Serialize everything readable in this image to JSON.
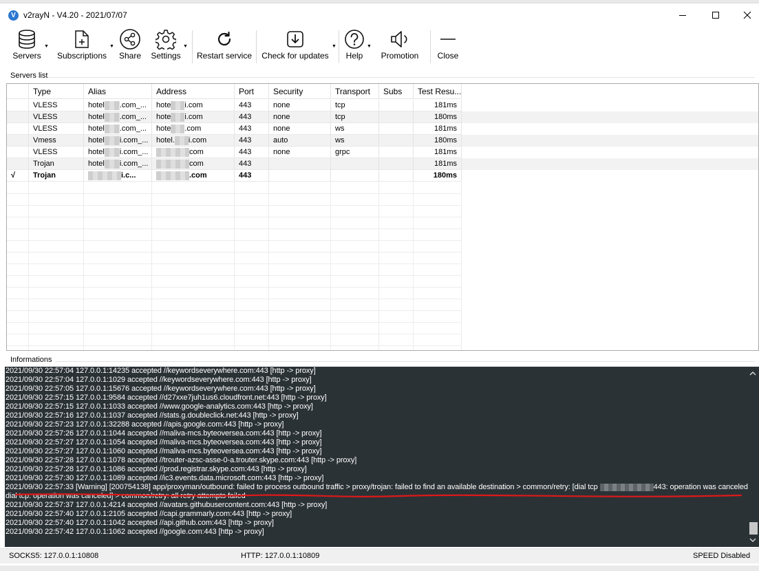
{
  "window": {
    "title": "v2rayN - V4.20 - 2021/07/07",
    "app_icon_letter": "V"
  },
  "toolbar": {
    "items": [
      {
        "label": "Servers",
        "icon": "database-icon",
        "dropdown": true
      },
      {
        "label": "Subscriptions",
        "icon": "document-plus-icon",
        "dropdown": true
      },
      {
        "label": "Share",
        "icon": "share-icon",
        "dropdown": false
      },
      {
        "label": "Settings",
        "icon": "gear-icon",
        "dropdown": true
      },
      {
        "label": "Restart service",
        "icon": "restart-icon",
        "dropdown": false
      },
      {
        "label": "Check for updates",
        "icon": "download-icon",
        "dropdown": true
      },
      {
        "label": "Help",
        "icon": "help-icon",
        "dropdown": true
      },
      {
        "label": "Promotion",
        "icon": "speaker-icon",
        "dropdown": false
      },
      {
        "label": "Close",
        "icon": "minus-icon",
        "dropdown": false
      }
    ]
  },
  "servers_section": {
    "label": "Servers list"
  },
  "servers_table": {
    "columns": [
      "",
      "Type",
      "Alias",
      "Address",
      "Port",
      "Security",
      "Transport",
      "Subs",
      "Test Resu..."
    ],
    "rows": [
      {
        "active": "",
        "type": "VLESS",
        "alias_a": "hotel",
        "alias_b": ".com_...",
        "address_a": "hote",
        "address_b": "i.com",
        "port": "443",
        "security": "none",
        "transport": "tcp",
        "subs": "",
        "test": "181ms"
      },
      {
        "active": "",
        "type": "VLESS",
        "alias_a": "hotel",
        "alias_b": ".com_...",
        "address_a": "hote",
        "address_b": "i.com",
        "port": "443",
        "security": "none",
        "transport": "tcp",
        "subs": "",
        "test": "180ms"
      },
      {
        "active": "",
        "type": "VLESS",
        "alias_a": "hotel",
        "alias_b": ".com_...",
        "address_a": "hote",
        "address_b": ".com",
        "port": "443",
        "security": "none",
        "transport": "ws",
        "subs": "",
        "test": "181ms"
      },
      {
        "active": "",
        "type": "Vmess",
        "alias_a": "hotel",
        "alias_b": "i.com_...",
        "address_a": "hotel.",
        "address_b": "i.com",
        "port": "443",
        "security": "auto",
        "transport": "ws",
        "subs": "",
        "test": "180ms"
      },
      {
        "active": "",
        "type": "VLESS",
        "alias_a": "hotel",
        "alias_b": "i.com_...",
        "address_a": "",
        "address_b": "com",
        "port": "443",
        "security": "none",
        "transport": "grpc",
        "subs": "",
        "test": "181ms"
      },
      {
        "active": "",
        "type": "Trojan",
        "alias_a": "hotel",
        "alias_b": "i.com_...",
        "address_a": "",
        "address_b": "com",
        "port": "443",
        "security": "",
        "transport": "",
        "subs": "",
        "test": "181ms"
      },
      {
        "active": "√",
        "type": "Trojan",
        "alias_a": "",
        "alias_b": "i.c...",
        "address_a": "",
        "address_b": ".com",
        "port": "443",
        "security": "",
        "transport": "",
        "subs": "",
        "test": "180ms"
      }
    ]
  },
  "info_section": {
    "label": "Informations"
  },
  "log": {
    "lines": [
      {
        "text": "2021/09/30 22:57:04 127.0.0.1:14235 accepted //keywordseverywhere.com:443 [http -> proxy]"
      },
      {
        "text": "2021/09/30 22:57:04 127.0.0.1:1029 accepted //keywordseverywhere.com:443 [http -> proxy]"
      },
      {
        "text": "2021/09/30 22:57:05 127.0.0.1:15676 accepted //keywordseverywhere.com:443 [http -> proxy]"
      },
      {
        "text": "2021/09/30 22:57:15 127.0.0.1:9584 accepted //d27xxe7juh1us6.cloudfront.net:443 [http -> proxy]"
      },
      {
        "text": "2021/09/30 22:57:15 127.0.0.1:1033 accepted //www.google-analytics.com:443 [http -> proxy]"
      },
      {
        "text": "2021/09/30 22:57:16 127.0.0.1:1037 accepted //stats.g.doubleclick.net:443 [http -> proxy]"
      },
      {
        "text": "2021/09/30 22:57:23 127.0.0.1:32288 accepted //apis.google.com:443 [http -> proxy]"
      },
      {
        "text": "2021/09/30 22:57:26 127.0.0.1:1044 accepted //maliva-mcs.byteoversea.com:443 [http -> proxy]"
      },
      {
        "text": "2021/09/30 22:57:27 127.0.0.1:1054 accepted //maliva-mcs.byteoversea.com:443 [http -> proxy]"
      },
      {
        "text": "2021/09/30 22:57:27 127.0.0.1:1060 accepted //maliva-mcs.byteoversea.com:443 [http -> proxy]"
      },
      {
        "text": "2021/09/30 22:57:28 127.0.0.1:1078 accepted //trouter-azsc-asse-0-a.trouter.skype.com:443 [http -> proxy]"
      },
      {
        "text": "2021/09/30 22:57:28 127.0.0.1:1086 accepted //prod.registrar.skype.com:443 [http -> proxy]"
      },
      {
        "text": "2021/09/30 22:57:30 127.0.0.1:1089 accepted //ic3.events.data.microsoft.com:443 [http -> proxy]"
      },
      {
        "text": "2021/09/30 22:57:33 [Warning] [200754138] app/proxyman/outbound: failed to process outbound traffic > proxy/trojan: failed to find an available destination > common/retry: [dial tcp ",
        "text_after": "443: operation was canceled"
      },
      {
        "text": "dial tcp: operation was canceled] > common/retry: all retry attempts failed"
      },
      {
        "text": "2021/09/30 22:57:37 127.0.0.1:4214 accepted //avatars.githubusercontent.com:443 [http -> proxy]"
      },
      {
        "text": "2021/09/30 22:57:40 127.0.0.1:2105 accepted //capi.grammarly.com:443 [http -> proxy]"
      },
      {
        "text": "2021/09/30 22:57:40 127.0.0.1:1042 accepted //api.github.com:443 [http -> proxy]"
      },
      {
        "text": "2021/09/30 22:57:42 127.0.0.1:1062 accepted //google.com:443 [http -> proxy]"
      }
    ]
  },
  "statusbar": {
    "socks": "SOCKS5:  127.0.0.1:10808",
    "http": "HTTP:  127.0.0.1:10809",
    "speed": "SPEED Disabled"
  },
  "colors": {
    "log_background": "#2b3236",
    "annotation_red": "#e01818",
    "app_icon": "#2c78d0"
  }
}
